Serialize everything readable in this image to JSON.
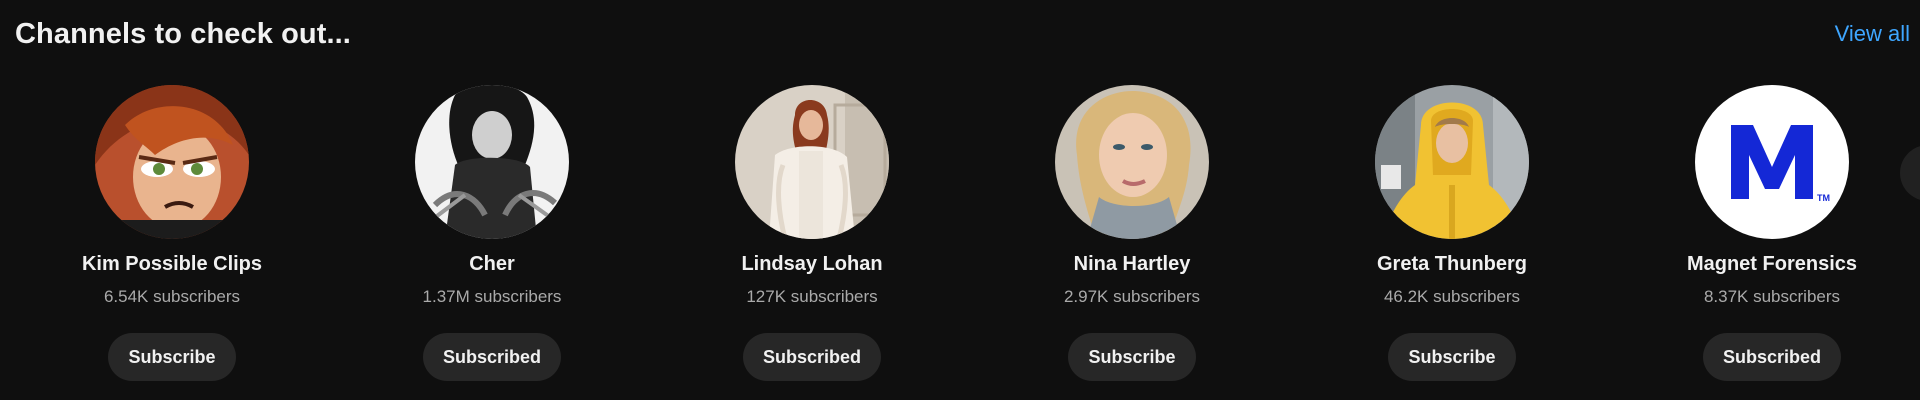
{
  "shelf": {
    "title": "Channels to check out...",
    "view_all_label": "View all"
  },
  "channels": [
    {
      "name": "Kim Possible Clips",
      "subscribers": "6.54K subscribers",
      "button_label": "Subscribe",
      "avatar": "cartoon-redhead-avatar"
    },
    {
      "name": "Cher",
      "subscribers": "1.37M subscribers",
      "button_label": "Subscribed",
      "avatar": "black-white-photo-avatar"
    },
    {
      "name": "Lindsay Lohan",
      "subscribers": "127K subscribers",
      "button_label": "Subscribed",
      "avatar": "photo-white-coat-avatar"
    },
    {
      "name": "Nina Hartley",
      "subscribers": "2.97K subscribers",
      "button_label": "Subscribe",
      "avatar": "photo-blonde-avatar"
    },
    {
      "name": "Greta Thunberg",
      "subscribers": "46.2K subscribers",
      "button_label": "Subscribe",
      "avatar": "photo-yellow-raincoat-avatar"
    },
    {
      "name": "Magnet Forensics",
      "subscribers": "8.37K subscribers",
      "button_label": "Subscribed",
      "avatar": "magnet-m-logo",
      "logo": {
        "letter": "M",
        "mark": "TM"
      }
    }
  ],
  "colors": {
    "background": "#0f0f0f",
    "link": "#3ea6ff",
    "button_bg": "#272727",
    "secondary_text": "#aaaaaa",
    "magnet_blue": "#1428d6"
  },
  "scroll_next": {
    "icon": "chevron-right-icon"
  }
}
